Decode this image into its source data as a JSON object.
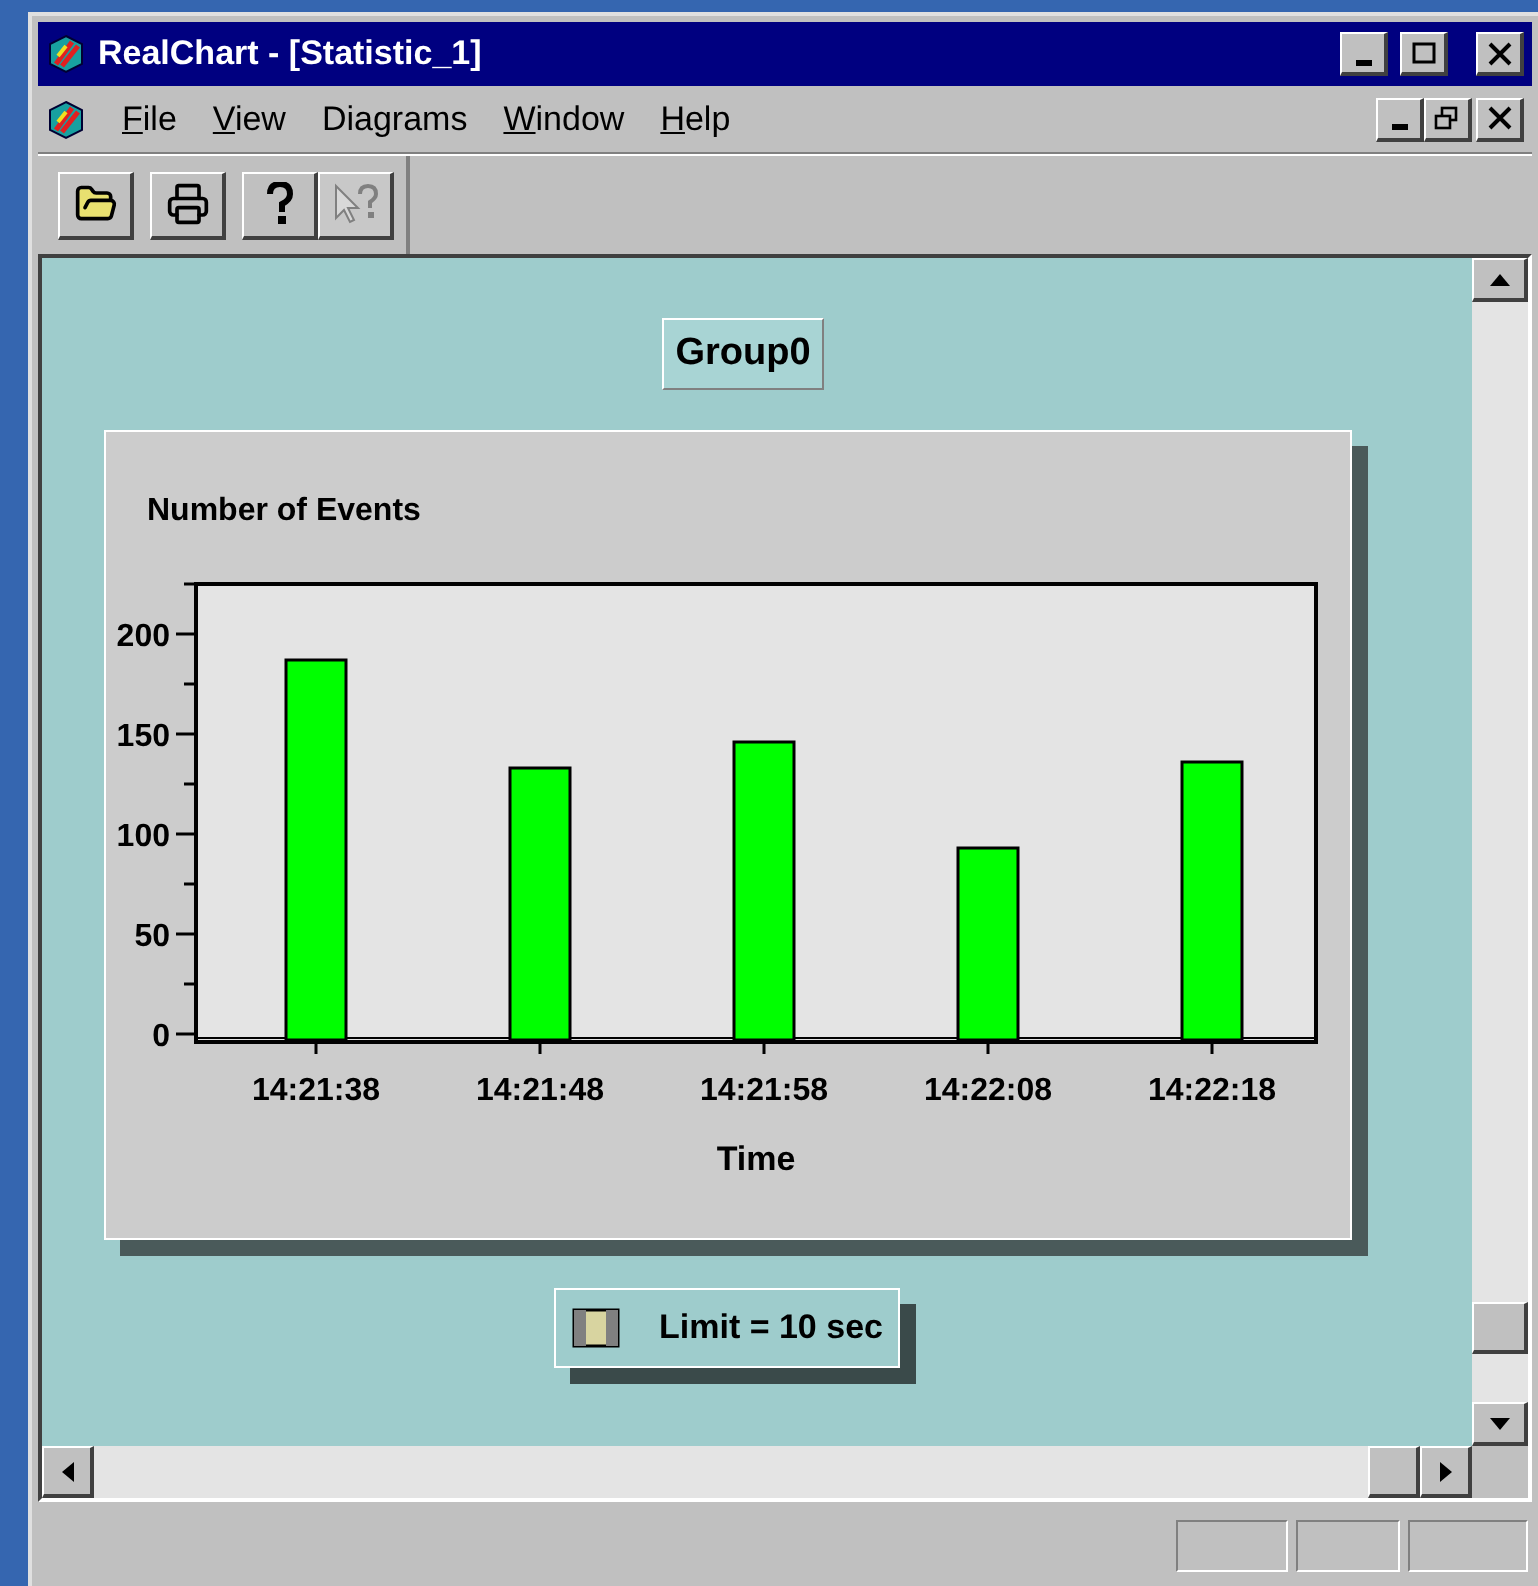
{
  "window": {
    "title": "RealChart - [Statistic_1]"
  },
  "menu": [
    {
      "label": "File",
      "underline": true
    },
    {
      "label": "View",
      "underline": true
    },
    {
      "label": "Diagrams",
      "underline": false
    },
    {
      "label": "Window",
      "underline": true
    },
    {
      "label": "Help",
      "underline": true
    }
  ],
  "toolbar": [
    {
      "kind": "open",
      "disabled": false
    },
    {
      "kind": "print",
      "disabled": false
    },
    {
      "kind": "help",
      "disabled": false
    },
    {
      "kind": "context-help",
      "disabled": true
    }
  ],
  "group_label": "Group0",
  "chart": {
    "title": "Number of Events",
    "chart_data": {
      "type": "bar",
      "xlabel": "Time",
      "categories": [
        "14:21:38",
        "14:21:48",
        "14:21:58",
        "14:22:08",
        "14:22:18"
      ],
      "series": [
        {
          "name": "Limit = 10 sec",
          "color": "#00ff00",
          "values": [
            187,
            133,
            146,
            93,
            136
          ]
        }
      ],
      "ylim": [
        0,
        225
      ],
      "yticks": [
        0,
        50,
        100,
        150,
        200
      ]
    }
  }
}
